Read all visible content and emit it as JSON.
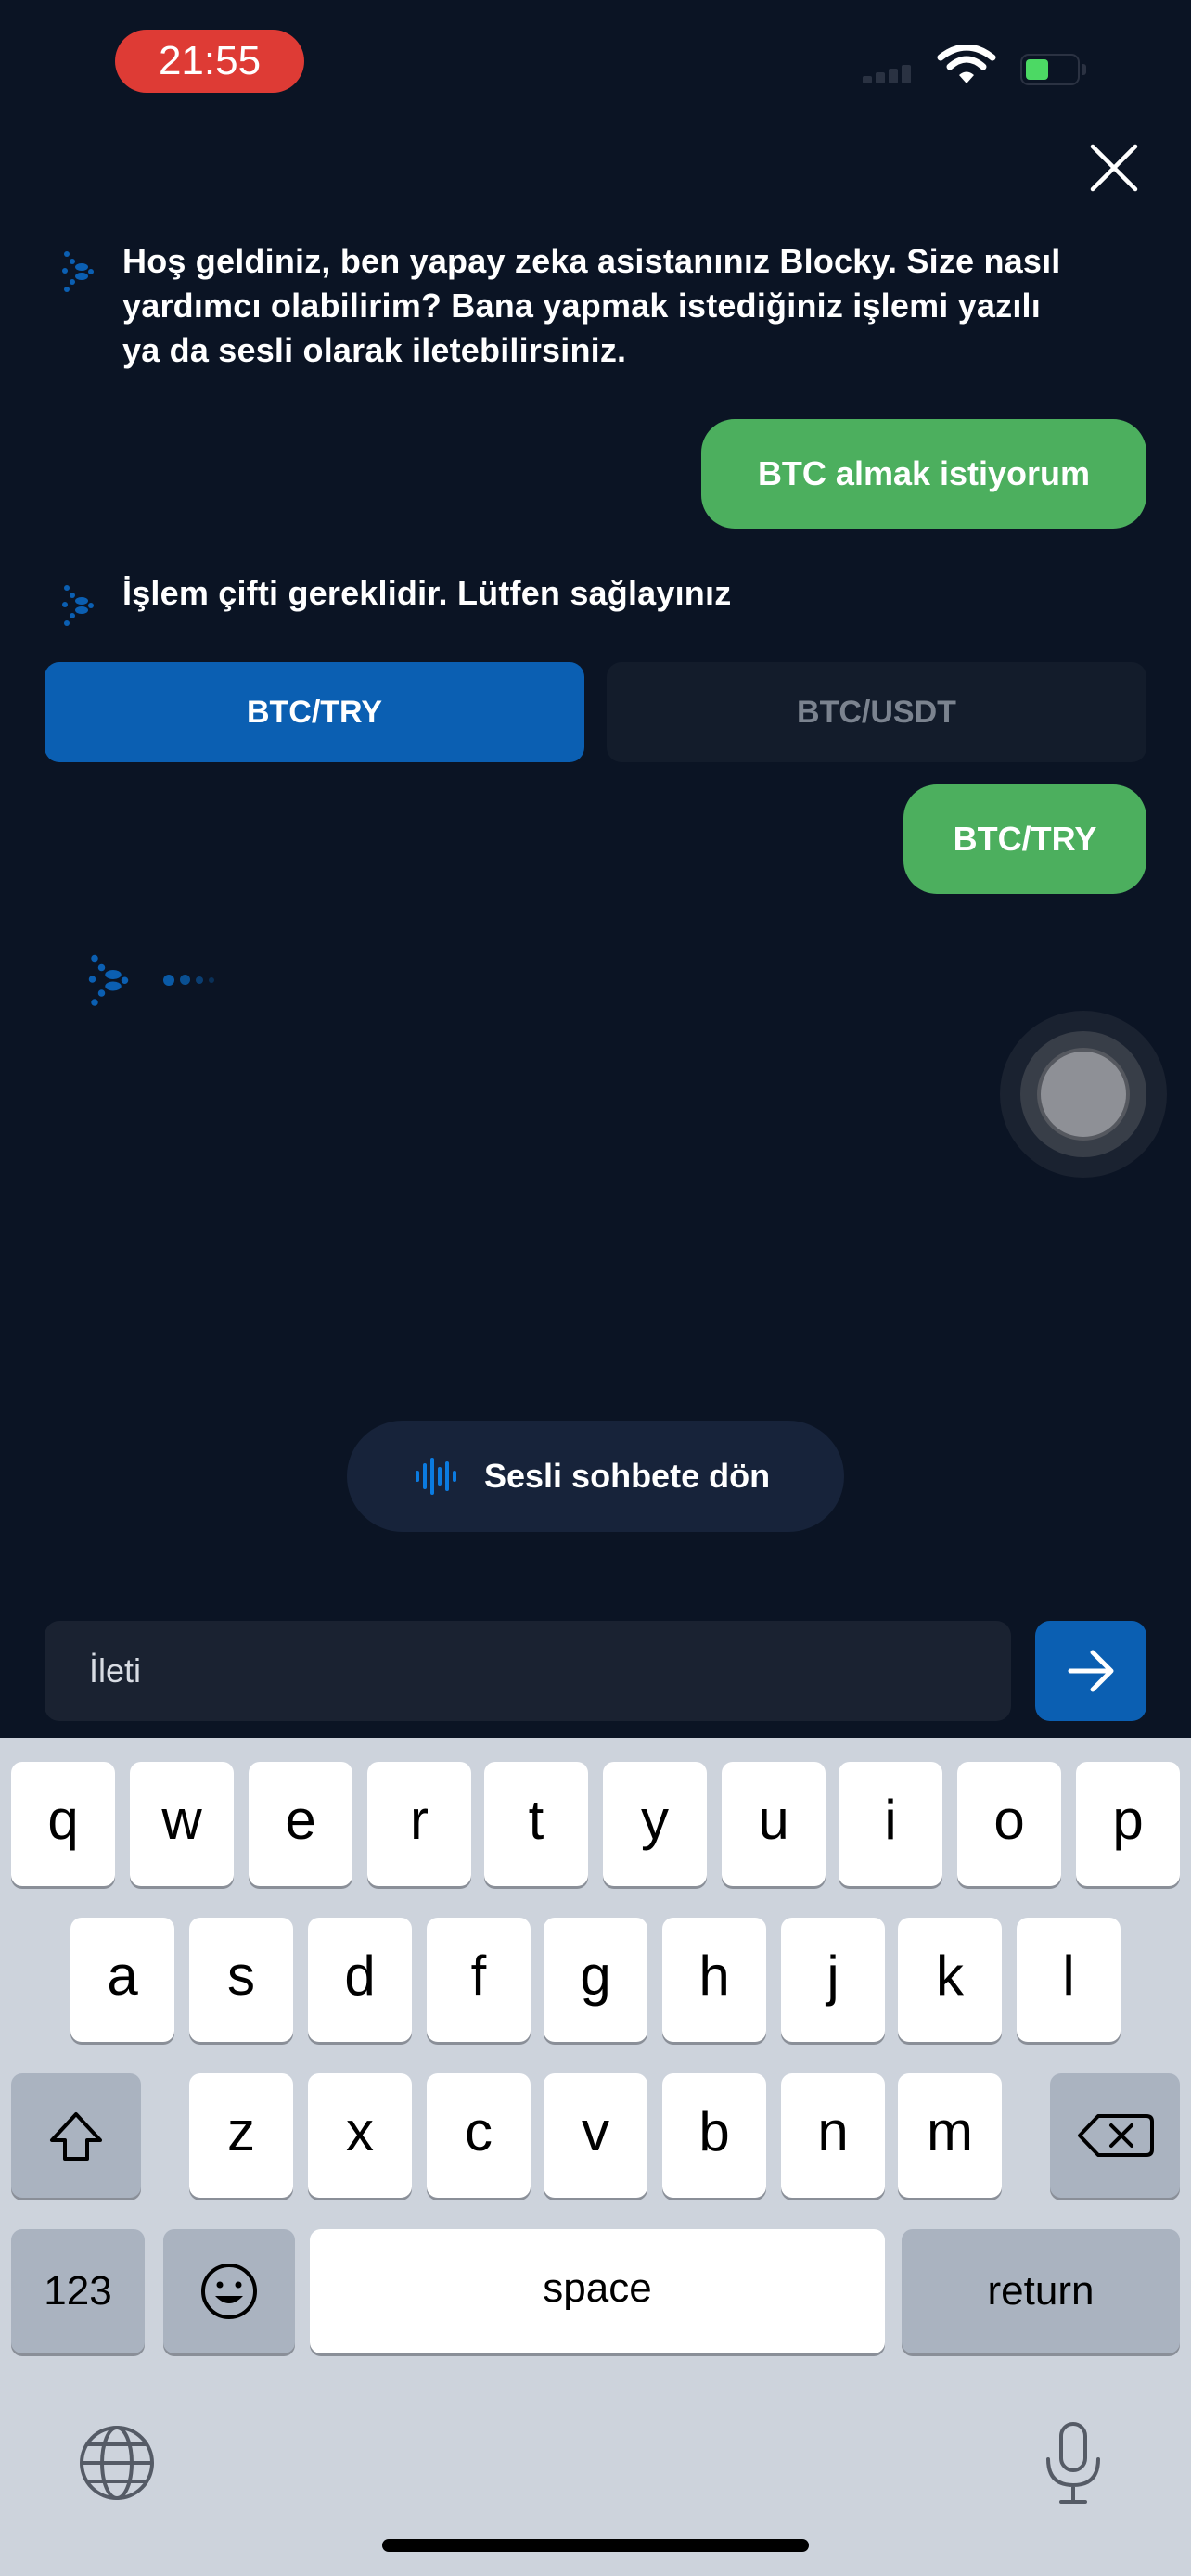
{
  "status_bar": {
    "time": "21:55"
  },
  "chat": {
    "messages": [
      {
        "role": "bot",
        "text_lines": [
          "Hoş geldiniz, ben yapay zeka asistanınız Blocky. Size nasıl",
          "yardımcı olabilirim? Bana yapmak istediğiniz işlemi yazılı",
          "ya da sesli olarak iletebilirsiniz."
        ]
      },
      {
        "role": "user",
        "text": "BTC almak istiyorum"
      },
      {
        "role": "bot",
        "text": "İşlem çifti gereklidir. Lütfen sağlayınız"
      },
      {
        "role": "options",
        "options": [
          {
            "label": "BTC/TRY",
            "selected": true
          },
          {
            "label": "BTC/USDT",
            "selected": false
          }
        ]
      },
      {
        "role": "user",
        "text": "BTC/TRY"
      }
    ]
  },
  "voice_chat_button": {
    "label": "Sesli sohbete dön"
  },
  "composer": {
    "placeholder": "İleti"
  },
  "keyboard": {
    "row1": [
      "q",
      "w",
      "e",
      "r",
      "t",
      "y",
      "u",
      "i",
      "o",
      "p"
    ],
    "row2": [
      "a",
      "s",
      "d",
      "f",
      "g",
      "h",
      "j",
      "k",
      "l"
    ],
    "row3": [
      "z",
      "x",
      "c",
      "v",
      "b",
      "n",
      "m"
    ],
    "numbers_key": "123",
    "space_key": "space",
    "return_key": "return"
  },
  "colors": {
    "background": "#0b1424",
    "accent_blue": "#0b5fb2",
    "user_bubble": "#4caf5e",
    "time_pill": "#de3b35"
  }
}
